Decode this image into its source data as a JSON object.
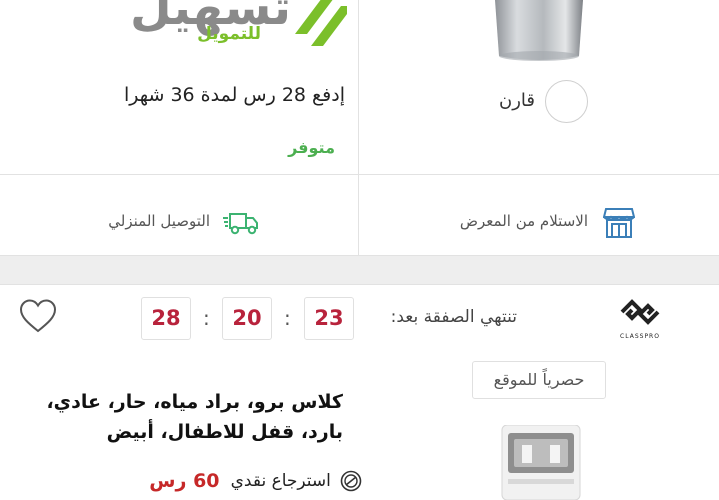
{
  "top_card": {
    "financing_logo": {
      "brand": "تسهيل",
      "tagline": "للتمويل",
      "colors": {
        "gray": "#8a8a8a",
        "green": "#7bbf2a"
      }
    },
    "installment_text": "إدفع 28 رس  لمدة 36 شهرا",
    "availability": "متوفر",
    "compare_label": "قارن",
    "delivery_option": "التوصيل المنزلي",
    "pickup_option": "الاستلام من المعرض"
  },
  "deal_card": {
    "deal_ends_label": "تنتهي الصفقة بعد:",
    "timer": {
      "hours": "23",
      "minutes": "20",
      "seconds": "28",
      "separator": ":"
    },
    "brand_logo_text": "CLASSPRO",
    "exclusive_badge": "حصرياً للموقع",
    "product_title": "كلاس برو، براد مياه، حار، عادي، بارد، قفل للاطفال، أبيض",
    "cashback_label": "استرجاع نقدي",
    "cashback_amount": "60 رس"
  },
  "colors": {
    "accent_red": "#b8233c",
    "available_green": "#4caf50",
    "cashback_red": "#c62828",
    "icon_blue": "#3b7fb8",
    "truck_green": "#3cb371"
  },
  "icons": [
    "truck-icon",
    "store-icon",
    "heart-icon",
    "cashback-icon",
    "compare-checkbox"
  ]
}
